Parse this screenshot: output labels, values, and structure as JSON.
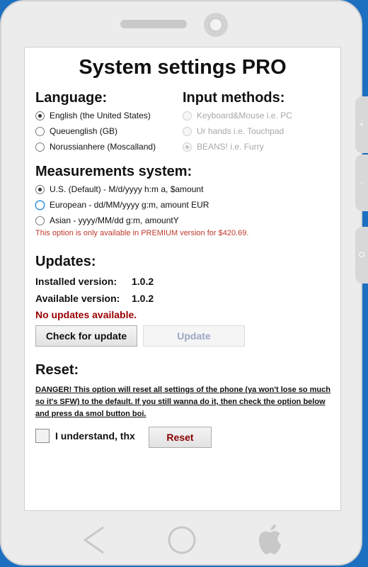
{
  "app": {
    "title": "System settings PRO"
  },
  "language": {
    "heading": "Language:",
    "options": [
      {
        "label": "English (the United States)",
        "checked": true
      },
      {
        "label": "Queuenglish (GB)",
        "checked": false
      },
      {
        "label": "Norussianhere (Moscalland)",
        "checked": false
      }
    ]
  },
  "input_methods": {
    "heading": "Input methods:",
    "options": [
      {
        "label": "Keyboard&Mouse i.e. PC",
        "checked": false
      },
      {
        "label": "Ur hands i.e. Touchpad",
        "checked": false
      },
      {
        "label": "BEANS! i.e. Furry",
        "checked": true
      }
    ]
  },
  "measurements": {
    "heading": "Measurements system:",
    "options": [
      {
        "label": "U.S. (Default) - M/d/yyyy h:m a, $amount",
        "checked": true
      },
      {
        "label": "European - dd/MM/yyyy g:m, amount EUR",
        "checked": false
      },
      {
        "label": "Asian - yyyy/MM/dd g:m, amountY",
        "checked": false
      }
    ],
    "premium_note": "This option is only available in PREMIUM version for $420.69."
  },
  "updates": {
    "heading": "Updates:",
    "installed_label": "Installed version:",
    "installed_value": "1.0.2",
    "available_label": "Available version:",
    "available_value": "1.0.2",
    "status": "No updates available.",
    "check_button": "Check for update",
    "update_button": "Update"
  },
  "reset": {
    "heading": "Reset:",
    "danger_text": "DANGER! This option will reset all settings of the phone (ya won't lose so much so it's SFW) to the default. If you still wanna do it, then check the option below and press da smol button boi.",
    "understand_label": "I understand, thx",
    "reset_button": "Reset"
  },
  "side_buttons": {
    "plus": "+",
    "minus": "-",
    "power": "O"
  },
  "colors": {
    "background": "#1d6fc0",
    "premium_note": "#c0392b",
    "status": "#9a0000"
  }
}
